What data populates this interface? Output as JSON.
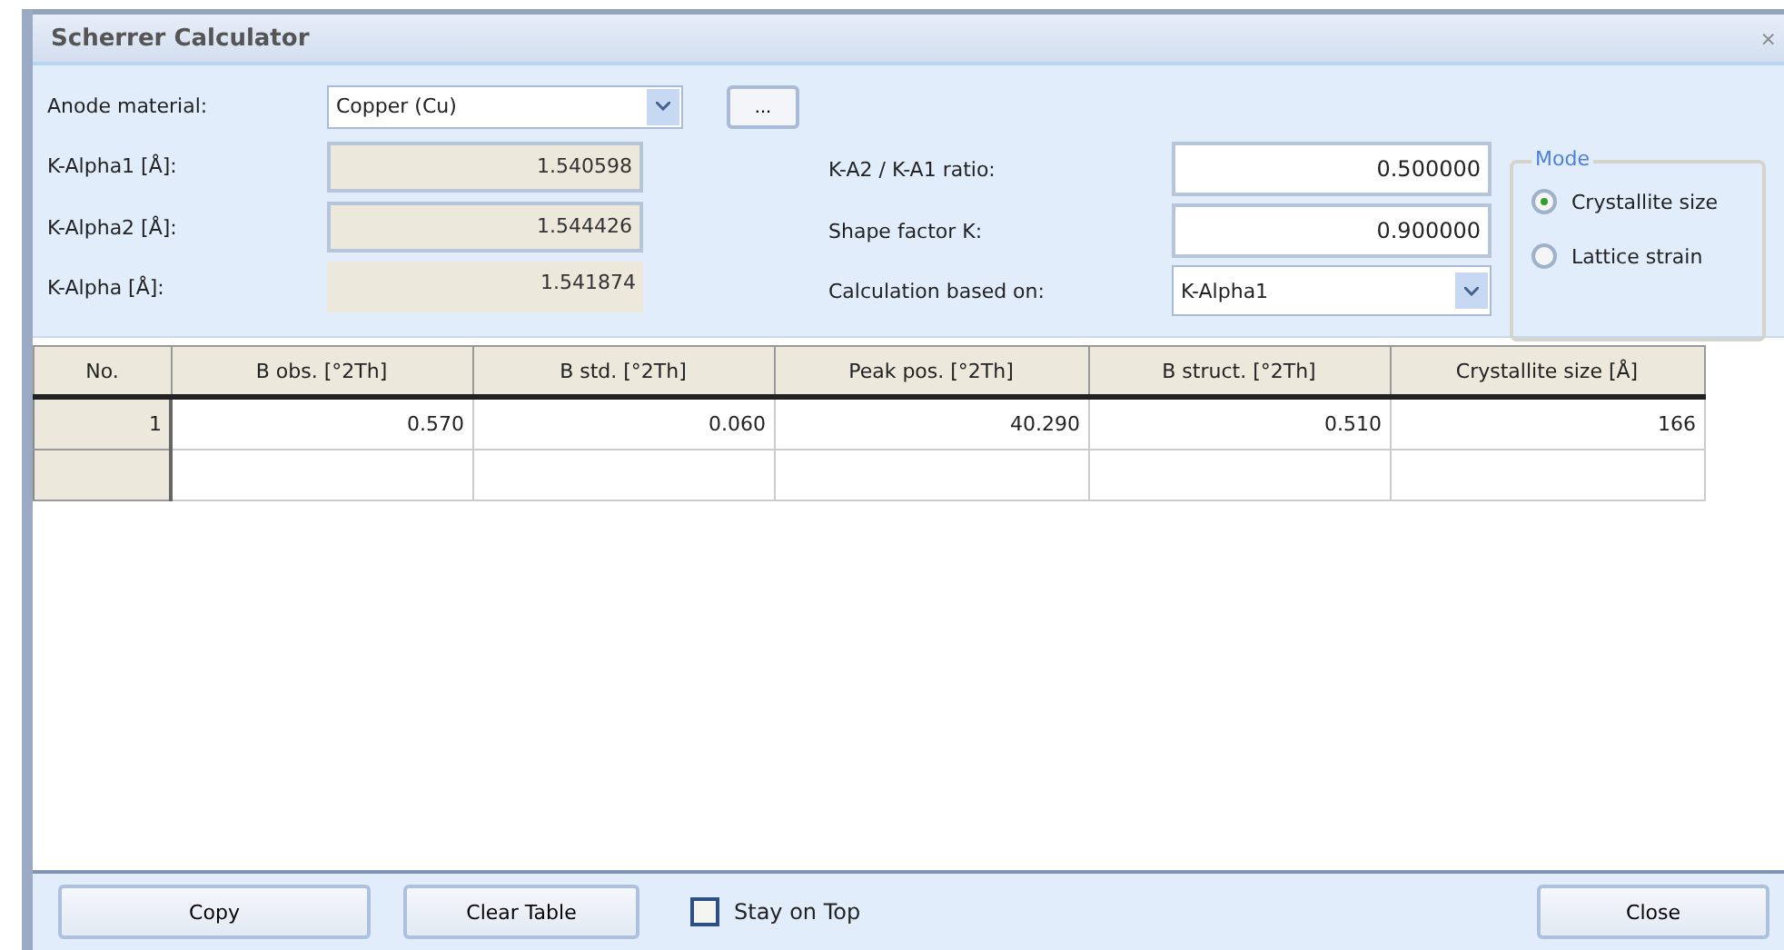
{
  "window": {
    "title": "Scherrer Calculator",
    "close": "×"
  },
  "anode": {
    "label": "Anode material:",
    "value": "Copper (Cu)",
    "more": "..."
  },
  "left_fields": [
    {
      "label": "K-Alpha1 [Å]:",
      "value": "1.540598",
      "framed": true
    },
    {
      "label": "K-Alpha2 [Å]:",
      "value": "1.544426",
      "framed": true
    },
    {
      "label": "K-Alpha [Å]:",
      "value": "1.541874",
      "framed": false
    }
  ],
  "right_fields": [
    {
      "label": "K-A2 / K-A1 ratio:",
      "value": "0.500000",
      "kind": "input"
    },
    {
      "label": "Shape factor K:",
      "value": "0.900000",
      "kind": "input"
    },
    {
      "label": "Calculation based on:",
      "value": "K-Alpha1",
      "kind": "dropdown"
    }
  ],
  "mode": {
    "title": "Mode",
    "options": [
      {
        "label": "Crystallite size",
        "selected": true
      },
      {
        "label": "Lattice strain",
        "selected": false
      }
    ]
  },
  "table": {
    "columns": [
      "No.",
      "B obs. [°2Th]",
      "B std. [°2Th]",
      "Peak pos. [°2Th]",
      "B struct. [°2Th]",
      "Crystallite size [Å]"
    ],
    "rows": [
      [
        "1",
        "0.570",
        "0.060",
        "40.290",
        "0.510",
        "166"
      ],
      [
        "",
        "",
        "",
        "",
        "",
        ""
      ]
    ]
  },
  "buttons": {
    "copy": "Copy",
    "clear": "Clear Table",
    "stay_on_top": {
      "label": "Stay on Top",
      "checked": false
    },
    "close": "Close"
  }
}
